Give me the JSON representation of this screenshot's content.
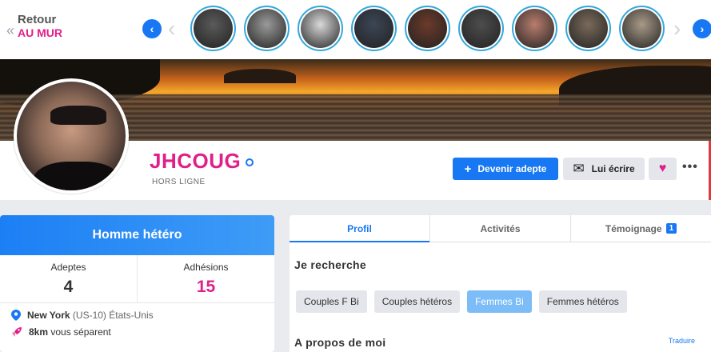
{
  "nav": {
    "back_line1": "Retour",
    "back_line2": "AU MUR",
    "prev_arrow": "‹",
    "next_arrow": "›",
    "thumbnails": [
      {
        "name": "thumb-1",
        "color": "#5a5a5a"
      },
      {
        "name": "thumb-2",
        "color": "#9a9a9a"
      },
      {
        "name": "thumb-3",
        "color": "#d9d9d9"
      },
      {
        "name": "thumb-4",
        "color": "#3c4656"
      },
      {
        "name": "thumb-5",
        "color": "#6b3a2a"
      },
      {
        "name": "thumb-6",
        "color": "#4d4d4d"
      },
      {
        "name": "thumb-7",
        "color": "#b87d6e"
      },
      {
        "name": "thumb-8",
        "color": "#7a6a5a"
      },
      {
        "name": "thumb-9",
        "color": "#a99a88"
      }
    ]
  },
  "profile": {
    "username": "JHCOUG",
    "status": "HORS LIGNE"
  },
  "actions": {
    "follow_icon": "+",
    "follow_label": "Devenir adepte",
    "write_icon": "✉",
    "write_label": "Lui écrire",
    "heart_icon": "♥",
    "more_icon": "•••"
  },
  "left_card": {
    "banner": "Homme hétéro",
    "stats": [
      {
        "label": "Adeptes",
        "value": "4",
        "color": "#333333"
      },
      {
        "label": "Adhésions",
        "value": "15",
        "color": "#e01f8a"
      }
    ],
    "location": {
      "city": "New York",
      "region": "(US-10) États-Unis",
      "distance_value": "8km",
      "distance_text": "vous séparent"
    }
  },
  "tabs": [
    {
      "label": "Profil",
      "active": true
    },
    {
      "label": "Activités",
      "active": false
    },
    {
      "label": "Témoignage",
      "badge": "1",
      "active": false
    }
  ],
  "looking_for": {
    "title": "Je recherche",
    "chips": [
      {
        "label": "Couples F Bi",
        "selected": false
      },
      {
        "label": "Couples hétéros",
        "selected": false
      },
      {
        "label": "Femmes Bi",
        "selected": true
      },
      {
        "label": "Femmes hétéros",
        "selected": false
      }
    ]
  },
  "about": {
    "title": "A propos de moi",
    "translate": "Traduire"
  },
  "colors": {
    "brand_blue": "#1877f2",
    "brand_pink": "#e01f8a",
    "accent_red": "#e0393e"
  }
}
